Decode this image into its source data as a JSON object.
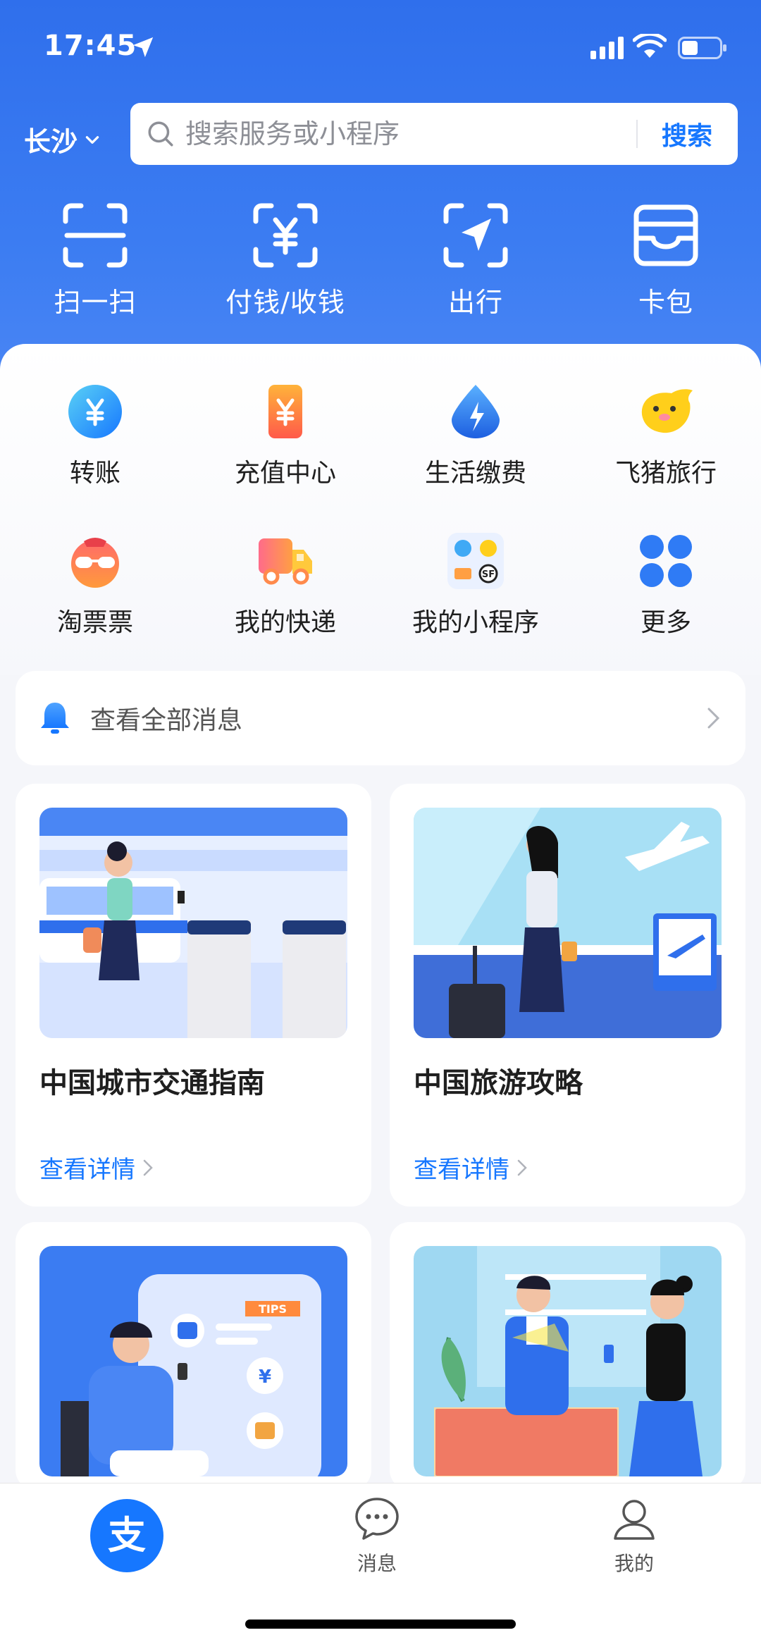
{
  "status": {
    "time": "17:45"
  },
  "header": {
    "city": "长沙",
    "search": {
      "placeholder": "搜索服务或小程序",
      "button": "搜索"
    }
  },
  "quick_actions": [
    {
      "label": "扫一扫",
      "icon": "scan-icon"
    },
    {
      "label": "付钱/收钱",
      "icon": "pay-icon"
    },
    {
      "label": "出行",
      "icon": "travel-icon"
    },
    {
      "label": "卡包",
      "icon": "wallet-icon"
    }
  ],
  "services": [
    {
      "label": "转账",
      "icon": "transfer-icon"
    },
    {
      "label": "充值中心",
      "icon": "recharge-icon"
    },
    {
      "label": "生活缴费",
      "icon": "utility-icon"
    },
    {
      "label": "飞猪旅行",
      "icon": "fliggy-icon"
    },
    {
      "label": "淘票票",
      "icon": "taopiaopiao-icon"
    },
    {
      "label": "我的快递",
      "icon": "delivery-truck-icon"
    },
    {
      "label": "我的小程序",
      "icon": "mini-programs-icon"
    },
    {
      "label": "更多",
      "icon": "more-grid-icon"
    }
  ],
  "messages": {
    "label": "查看全部消息"
  },
  "cards": [
    {
      "title": "中国城市交通指南",
      "link": "查看详情"
    },
    {
      "title": "中国旅游攻略",
      "link": "查看详情"
    },
    {
      "title": "",
      "link": ""
    },
    {
      "title": "",
      "link": ""
    }
  ],
  "tabbar": {
    "home_glyph": "支",
    "messages": "消息",
    "mine": "我的"
  },
  "colors": {
    "primary": "#1677ff",
    "header": "#2f6fec"
  }
}
